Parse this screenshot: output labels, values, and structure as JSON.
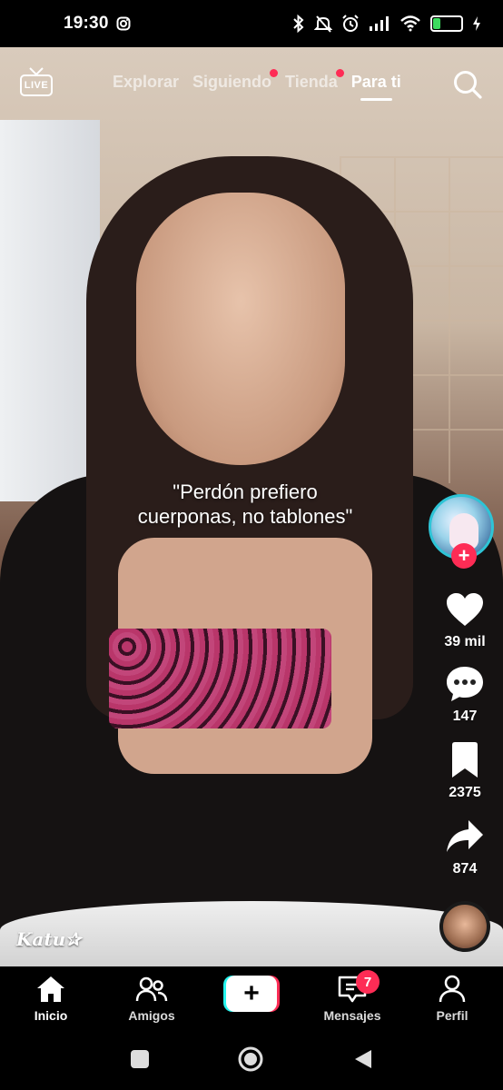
{
  "status_bar": {
    "time": "19:30",
    "battery": "26",
    "icons": [
      "instagram-icon",
      "bluetooth-icon",
      "mute-icon",
      "alarm-icon",
      "signal-icon",
      "wifi-icon",
      "battery-icon",
      "charging-icon"
    ]
  },
  "top_nav": {
    "live_label": "LIVE",
    "tabs": [
      {
        "label": "Explorar",
        "has_dot": false
      },
      {
        "label": "Siguiendo",
        "has_dot": true
      },
      {
        "label": "Tienda",
        "has_dot": true
      },
      {
        "label": "Para ti",
        "has_dot": false,
        "active": true
      }
    ],
    "search_icon": "search-icon"
  },
  "video": {
    "caption_line1": "\"Perdón prefiero",
    "caption_line2": "cuerponas, no tablones\"",
    "watermark": "Katu✰"
  },
  "actions": {
    "follow_symbol": "+",
    "likes": "39 mil",
    "comments": "147",
    "saves": "2375",
    "shares": "874"
  },
  "bottom_nav": {
    "home": "Inicio",
    "friends": "Amigos",
    "create_symbol": "+",
    "inbox": "Mensajes",
    "inbox_badge": "7",
    "profile": "Perfil"
  },
  "colors": {
    "accent": "#fe2c55",
    "cyan": "#25f4ee",
    "avatar_ring": "#2ec4d6"
  }
}
